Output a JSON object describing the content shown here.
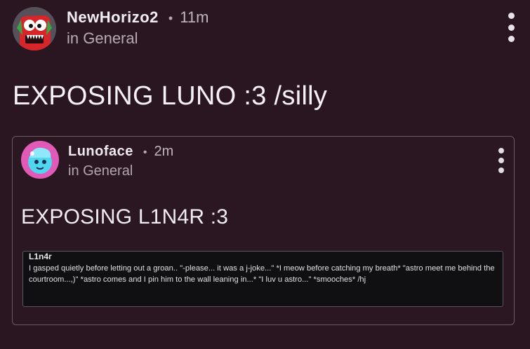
{
  "post": {
    "author": "NewHorizo2",
    "separator": "•",
    "time": "11m",
    "community": "in General",
    "title": "EXPOSING LUNO :3 /silly",
    "more_icon": "more-vertical-icon"
  },
  "embed": {
    "author": "Lunoface",
    "separator": "•",
    "time": "2m",
    "community": "in General",
    "title": "EXPOSING L1N4R :3",
    "more_icon": "more-vertical-icon",
    "quote": {
      "name": "L1n4r",
      "text": "I gasped quietly before letting out a groan.. \"-please... it was a j-joke...\" *I meow before catching my breath* \"astro meet me behind the courtroom...,)\" *astro comes and I pin him to the wall leaning in...* \"I luv u astro...\" *smooches* /hj"
    }
  },
  "colors": {
    "background": "#2a1621",
    "avatar_red": "#d6262a",
    "avatar_green": "#3aa64a",
    "embed_avatar_pink": "#e15ab8",
    "embed_avatar_cyan": "#4fd7f0",
    "quote_background": "#101013"
  }
}
